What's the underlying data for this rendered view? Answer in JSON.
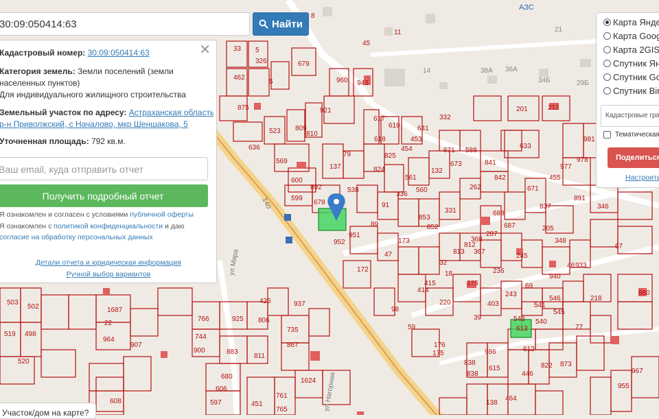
{
  "search": {
    "value": "30:09:050414:63",
    "button_label": "Найти"
  },
  "info": {
    "cad_label": "Кадастровый номер:",
    "cad_value": "30:09:050414:63",
    "category_label": "Категория земель:",
    "category_value_1": "Земли поселений (земли",
    "category_value_2": "населенных пунктов)",
    "use_value": "Для индивидуального жилищного строительства",
    "address_label": "Земельный участок по адресу:",
    "address_link_1": "Астраханская область,",
    "address_link_2": "р-н Приволжский, с Началово, мкр Шеншакова, 5",
    "area_label": "Уточненная площадь:",
    "area_value": "792 кв.м.",
    "email_placeholder": "Ваш email, куда отправить отчет",
    "report_button": "Получить подробный отчет",
    "consent_1a": "Я ознакомлен и согласен с условиями ",
    "consent_1b": "публичной оферты",
    "consent_2a": "Я ознакомлен с ",
    "consent_2b": "политикой конфиденциальности",
    "consent_2c": " и даю",
    "consent_3": "согласие на обработку персональных данных",
    "details_link": "Детали отчета и юридическая информация",
    "manual_link": "Ручной выбор вариантов"
  },
  "layers": {
    "options": [
      "Карта Яндекс",
      "Карта Google",
      "Карта 2GIS",
      "Спутник Яндекс",
      "Спутник Google",
      "Спутник Bing"
    ],
    "selected_index": 0,
    "select_value": "Кадастровые границы",
    "thematic_label": "Тематическая карта",
    "share_button": "Поделиться",
    "setup_link": "Настроить"
  },
  "bottom_tip": "Участок/дом на карте?",
  "map_labels": {
    "azs": "АЗС",
    "street_1": "ул Мира",
    "street_2": "ул Нагорная",
    "road": "140",
    "bus": "Б"
  },
  "parcels": [
    "33",
    "5",
    "8",
    "23",
    "45",
    "11",
    "21",
    "326",
    "679",
    "14",
    "38А",
    "36А",
    "29Б",
    "462",
    "54",
    "960",
    "943",
    "34Б",
    "875",
    "921",
    "332",
    "201",
    "212",
    "633",
    "636",
    "523",
    "809",
    "617",
    "619",
    "641",
    "2",
    "569",
    "810",
    "618",
    "825",
    "454",
    "671",
    "673",
    "588",
    "137",
    "79",
    "824",
    "132",
    "977",
    "981",
    "978",
    "600",
    "892",
    "538",
    "561",
    "560",
    "842",
    "841",
    "455",
    "891",
    "599",
    "678",
    "91",
    "336",
    "331",
    "262",
    "671",
    "837",
    "205",
    "852",
    "853",
    "547",
    "57",
    "952",
    "951",
    "687",
    "688",
    "287",
    "67",
    "346",
    "348",
    "46",
    "47",
    "417",
    "173",
    "813",
    "812",
    "368",
    "367",
    "245",
    "172",
    "415",
    "414",
    "32",
    "18",
    "236",
    "933",
    "940",
    "69",
    "503",
    "502",
    "1687",
    "22",
    "964",
    "907",
    "744",
    "900",
    "883",
    "925",
    "806",
    "426",
    "935",
    "220",
    "275",
    "403",
    "243",
    "546",
    "218",
    "541",
    "545",
    "880",
    "519",
    "498",
    "520",
    "766",
    "735",
    "867",
    "811",
    "1624",
    "761",
    "680",
    "606",
    "597",
    "765",
    "451",
    "608",
    "838",
    "986",
    "615",
    "612",
    "822",
    "838",
    "873",
    "967",
    "955",
    "138",
    "464",
    "446",
    "543",
    "540",
    "612",
    "613",
    "937",
    "176",
    "175",
    "59",
    "98",
    "39",
    "77"
  ]
}
